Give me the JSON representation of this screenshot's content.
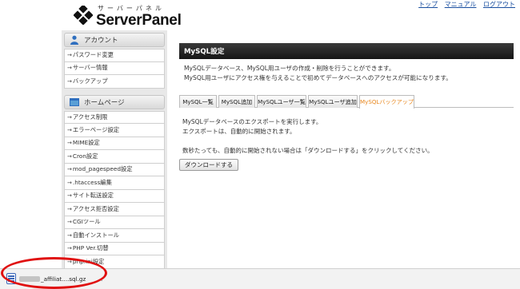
{
  "header": {
    "logo_kana": "サーバーパネル",
    "logo_text": "ServerPanel",
    "links": [
      "トップ",
      "マニュアル",
      "ログアウト"
    ]
  },
  "sidebar": {
    "sections": [
      {
        "title": "アカウント",
        "icon": "user-icon",
        "items": [
          "パスワード変更",
          "サーバー情報",
          "バックアップ"
        ]
      },
      {
        "title": "ホームページ",
        "icon": "homepage-icon",
        "items": [
          "アクセス制限",
          "エラーページ設定",
          "MIME設定",
          "Cron設定",
          "mod_pagespeed設定",
          ".htaccess編集",
          "サイト転送設定",
          "アクセス拒否設定",
          "CGIツール",
          "自動インストール",
          "PHP Ver.切替",
          "php.ini設定"
        ]
      }
    ]
  },
  "main": {
    "title": "MySQL設定",
    "description": [
      "MySQLデータベース、MySQL用ユーザの作成・削除を行うことができます。",
      "MySQL用ユーザにアクセス権を与えることで初めてデータベースへのアクセスが可能になります。"
    ],
    "tabs": [
      "MySQL一覧",
      "MySQL追加",
      "MySQLユーザ一覧",
      "MySQLユーザ追加",
      "MySQLバックアップ"
    ],
    "active_tab": 4,
    "content": [
      "MySQLデータベースのエクスポートを実行します。",
      "エクスポートは、自動的に開始されます。",
      "数秒たっても、自動的に開始されない場合は「ダウンロードする」をクリックしてください。"
    ],
    "download_button": "ダウンロードする"
  },
  "download_bar": {
    "file_name": "_affiliat....sql.gz",
    "highlight_color": "#e01010"
  }
}
